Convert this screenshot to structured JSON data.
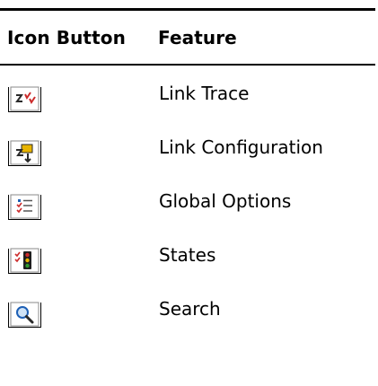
{
  "table": {
    "headers": {
      "icon_button": "Icon Button",
      "feature": "Feature"
    },
    "rows": [
      {
        "feature": "Link Trace",
        "icon": "link-trace-icon"
      },
      {
        "feature": "Link Configuration",
        "icon": "link-configuration-icon"
      },
      {
        "feature": "Global Options",
        "icon": "global-options-icon"
      },
      {
        "feature": "States",
        "icon": "states-icon"
      },
      {
        "feature": "Search",
        "icon": "search-icon"
      }
    ]
  },
  "colors": {
    "rule": "#000000",
    "icon_red": "#cc2b2b",
    "icon_green": "#2e9a2e",
    "icon_blue": "#1d5fb5",
    "icon_yellow": "#e8b400"
  }
}
